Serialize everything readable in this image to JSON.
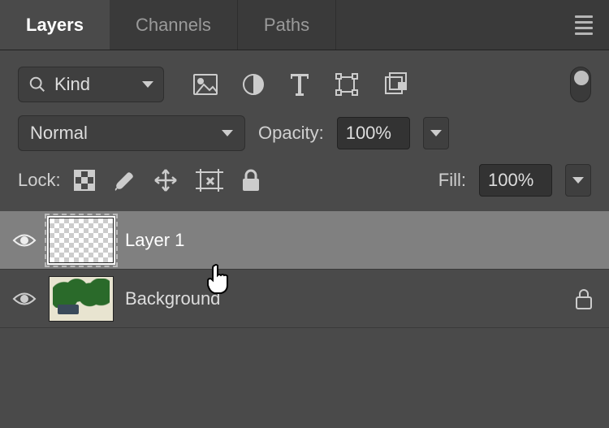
{
  "tabs": {
    "layers": "Layers",
    "channels": "Channels",
    "paths": "Paths"
  },
  "filter": {
    "kind_label": "Kind"
  },
  "blend": {
    "mode": "Normal",
    "opacity_label": "Opacity:",
    "opacity_value": "100%"
  },
  "locks": {
    "label": "Lock:",
    "fill_label": "Fill:",
    "fill_value": "100%"
  },
  "layers": [
    {
      "name": "Layer 1",
      "visible": true,
      "selected": true,
      "kind": "transparent"
    },
    {
      "name": "Background",
      "visible": true,
      "selected": false,
      "kind": "image",
      "locked": true
    }
  ]
}
